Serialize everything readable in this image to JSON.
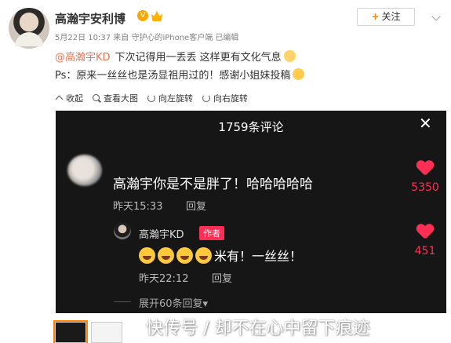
{
  "post": {
    "username": "高瀚宇安利博",
    "verified_badge": "V",
    "meta": "5月22日 10:37 来自 守护心的iPhone客户端  已编辑",
    "follow_label": "关注",
    "line1_mention": "@高瀚宇KD",
    "line1_text": "下次记得用一丢丢 这样更有文化气息",
    "line2_text": "Ps：原来一丝丝也是汤显祖用过的！感谢小姐妹投稿"
  },
  "toolbar": {
    "collapse": "收起",
    "view_large": "查看大图",
    "rotate_left": "向左旋转",
    "rotate_right": "向右旋转"
  },
  "comments_panel": {
    "title": "1759条评论",
    "close": "✕",
    "comment1": {
      "text": "高瀚宇你是不是胖了！哈哈哈哈哈",
      "time": "昨天15:33",
      "reply": "回复",
      "likes": "5350"
    },
    "comment2": {
      "name": "高瀚宇KD",
      "author_tag": "作者",
      "text": "米有！一丝丝！",
      "time": "昨天22:12",
      "reply": "回复",
      "likes": "451"
    },
    "expand": "展开60条回复▾"
  },
  "watermark": "快传号 / 却不在心中留下痕迹",
  "colors": {
    "accent": "#eb7350",
    "like": "#ff2e55",
    "dark_bg": "#161616"
  }
}
